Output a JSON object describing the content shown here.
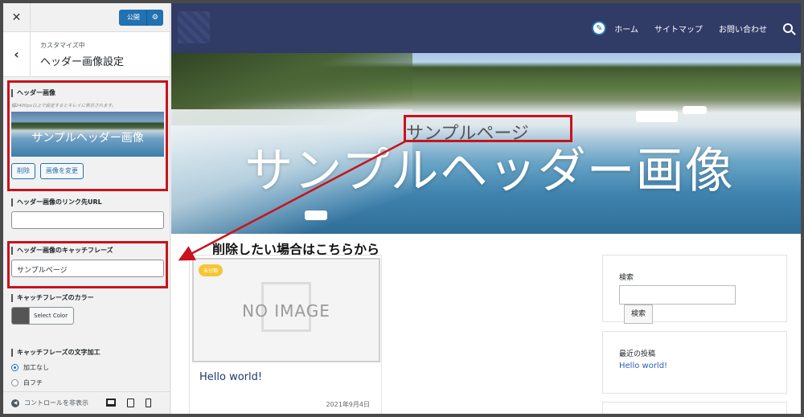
{
  "sidebar": {
    "close_icon": "close-icon",
    "publish_label": "公開",
    "section_sub": "カスタマイズ中",
    "section_title": "ヘッダー画像設定",
    "header_image": {
      "title": "ヘッダー画像",
      "hint": "幅2400px以上で設定するとキレイに表示されます。",
      "thumb_text": "サンプルヘッダー画像",
      "remove_label": "削除",
      "change_label": "画像を変更"
    },
    "link_url": {
      "title": "ヘッダー画像のリンク先URL",
      "value": ""
    },
    "catchphrase": {
      "title": "ヘッダー画像のキャッチフレーズ",
      "value": "サンプルページ"
    },
    "catch_color": {
      "title": "キャッチフレーズのカラー",
      "button_label": "Select Color",
      "swatch": "#555555"
    },
    "catch_style": {
      "title": "キャッチフレーズの文字加工",
      "options": [
        "加工なし",
        "白フチ"
      ],
      "selected": "加工なし"
    },
    "hide_controls_label": "コントロールを非表示"
  },
  "preview": {
    "nav": {
      "home": "ホーム",
      "sitemap": "サイトマップ",
      "contact": "お問い合わせ"
    },
    "hero_title": "サンプルヘッダー画像",
    "catchphrase": "サンプルページ",
    "annotation": "削除したい場合はこちらから",
    "post": {
      "category": "未分類",
      "no_image": "NO IMAGE",
      "title": "Hello world!",
      "date": "2021年9月4日"
    },
    "widgets": {
      "search_title": "検索",
      "search_button": "検索",
      "recent_title": "最近の投稿",
      "recent_items": [
        "Hello world!"
      ]
    }
  },
  "colors": {
    "accent": "#2271b1",
    "header_bg": "#303b66",
    "annotation_red": "#c8131d",
    "badge": "#f5c634"
  }
}
